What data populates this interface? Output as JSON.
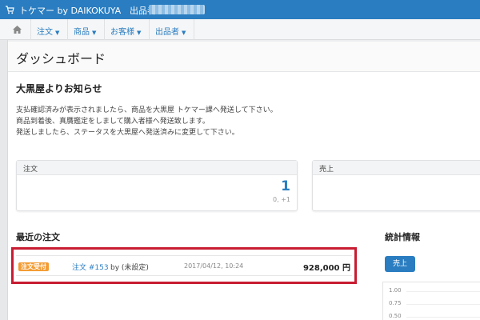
{
  "topbar": {
    "brand": "トケマー by DAIKOKUYA",
    "seller_label": "出品者:",
    "bg_color": "#2a7dc0"
  },
  "nav": {
    "home_icon": "home-icon",
    "items": [
      {
        "label": "注文"
      },
      {
        "label": "商品"
      },
      {
        "label": "お客様"
      },
      {
        "label": "出品者"
      }
    ]
  },
  "page": {
    "title": "ダッシュボード"
  },
  "notice": {
    "title": "大黒屋よりお知らせ",
    "lines": [
      "支払確認済みが表示されましたら、商品を大黒屋 トケマー課へ発送して下さい。",
      "商品到着後、真贋鑑定をしまして購入者様へ発送致します。",
      "発送しましたら、ステータスを大黒屋へ発送済みに変更して下さい。"
    ]
  },
  "panels": {
    "orders": {
      "title": "注文",
      "value": "1",
      "sub": "0, +1"
    },
    "sales": {
      "title": "売上"
    }
  },
  "recent_orders": {
    "title": "最近の注文",
    "rows": [
      {
        "status": "注文受付",
        "link": "注文 #153",
        "by": "by (未設定)",
        "date": "2017/04/12, 10:24",
        "amount": "928,000 円"
      }
    ]
  },
  "stats": {
    "title": "統計情報",
    "button": "売上",
    "ticks": [
      "1.00",
      "0.75",
      "0.50"
    ]
  },
  "colors": {
    "accent": "#2a7dc0",
    "highlight": "#c81c32",
    "badge": "#f39c34"
  }
}
